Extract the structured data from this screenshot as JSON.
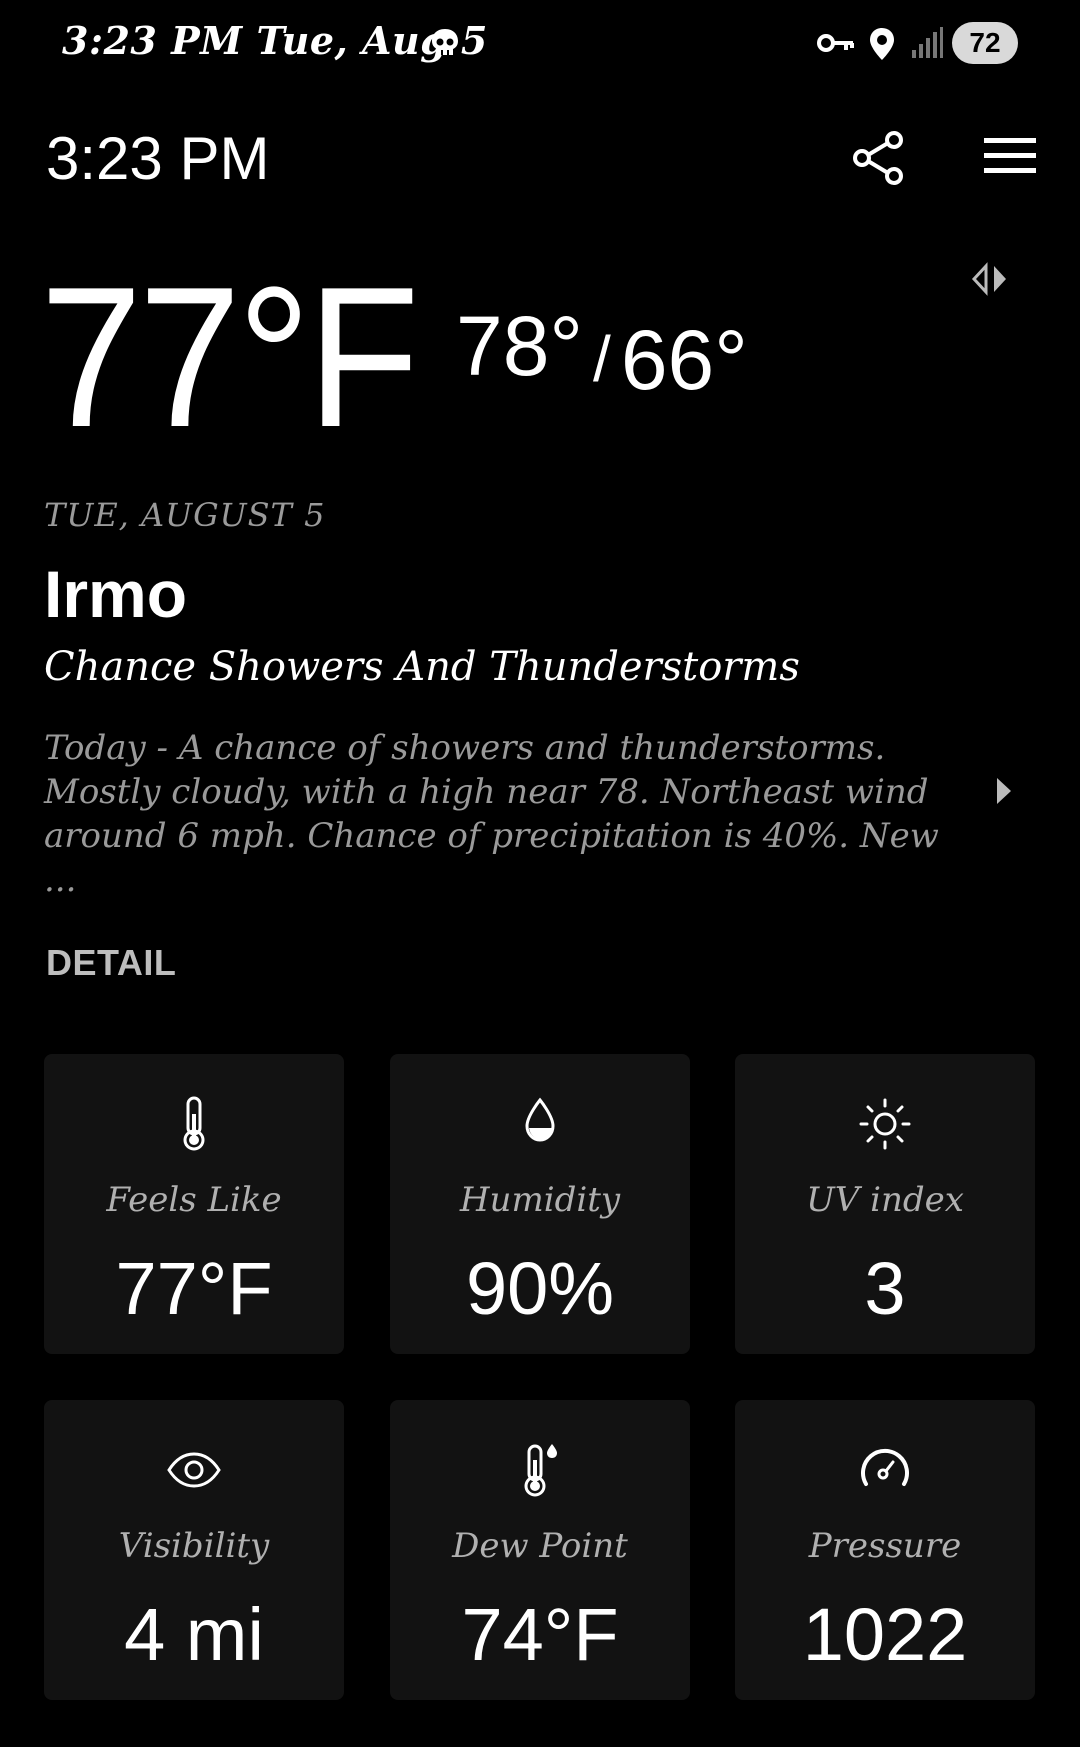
{
  "status_bar": {
    "time_date": "3:23 PM  Tue, Aug 5",
    "battery": "72",
    "icons": [
      "skull-icon",
      "vpn-key-icon",
      "location-icon",
      "signal-icon",
      "battery-icon"
    ]
  },
  "app_bar": {
    "time": "3:23 PM",
    "icons": [
      "share-icon",
      "menu-icon"
    ]
  },
  "current": {
    "temp": "77°F",
    "high": "78°",
    "separator": "/",
    "low": "66°",
    "date": "TUE, AUGUST 5",
    "city": "Irmo",
    "condition": "Chance Showers And Thunderstorms",
    "description": "Today - A chance of showers and thunderstorms. Mostly cloudy, with a high near 78. Northeast wind around 6 mph.  Chance of precipitation is 40%. New ..."
  },
  "detail": {
    "header": "DETAIL",
    "cards": [
      {
        "label": "Feels Like",
        "value": "77°F",
        "icon": "thermometer-icon"
      },
      {
        "label": "Humidity",
        "value": "90%",
        "icon": "droplet-icon"
      },
      {
        "label": "UV index",
        "value": "3",
        "icon": "sun-icon"
      },
      {
        "label": "Visibility",
        "value": "4 mi",
        "icon": "eye-icon"
      },
      {
        "label": "Dew Point",
        "value": "74°F",
        "icon": "dew-point-icon"
      },
      {
        "label": "Pressure",
        "value": "1022",
        "icon": "gauge-icon"
      }
    ]
  }
}
